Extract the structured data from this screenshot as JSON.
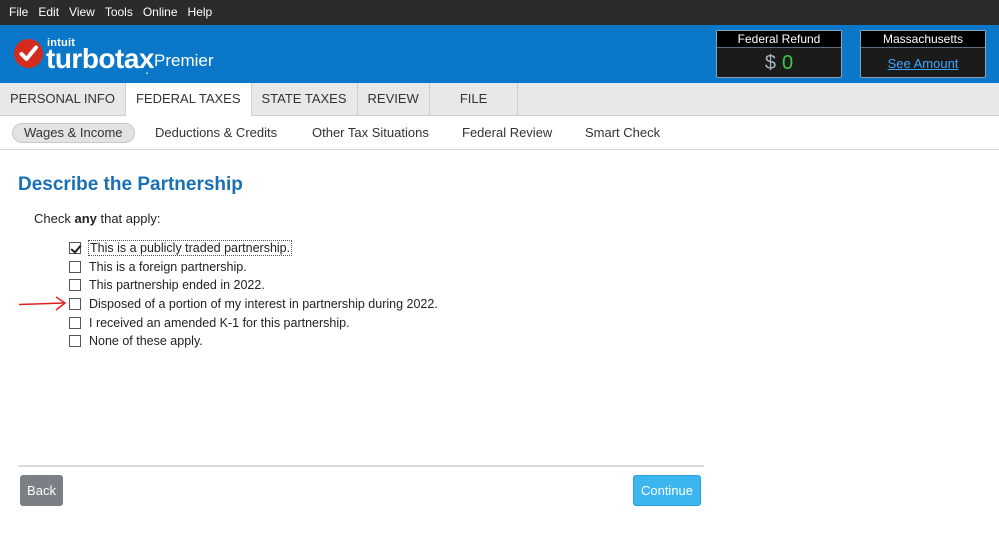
{
  "menu": [
    "File",
    "Edit",
    "View",
    "Tools",
    "Online",
    "Help"
  ],
  "brand": {
    "intuit": "intuit",
    "product": "turbotax",
    "edition": "Premier"
  },
  "refunds": {
    "federal": {
      "label": "Federal Refund",
      "currency": "$",
      "amount": "0"
    },
    "state": {
      "label": "Massachusetts",
      "link": "See Amount"
    }
  },
  "tabs": [
    {
      "label": "PERSONAL INFO",
      "active": false
    },
    {
      "label": "FEDERAL TAXES",
      "active": true
    },
    {
      "label": "STATE TAXES",
      "active": false
    },
    {
      "label": "REVIEW",
      "active": false
    },
    {
      "label": "FILE",
      "active": false
    }
  ],
  "subtabs": [
    {
      "label": "Wages & Income",
      "active": true
    },
    {
      "label": "Deductions & Credits",
      "active": false
    },
    {
      "label": "Other Tax Situations",
      "active": false
    },
    {
      "label": "Federal Review",
      "active": false
    },
    {
      "label": "Smart Check",
      "active": false
    }
  ],
  "page": {
    "title": "Describe the Partnership",
    "instruction_pre": "Check ",
    "instruction_bold": "any",
    "instruction_post": " that apply:"
  },
  "options": [
    {
      "label": "This is a publicly traded partnership.",
      "checked": true
    },
    {
      "label": "This is a foreign partnership.",
      "checked": false
    },
    {
      "label": "This partnership ended in 2022.",
      "checked": false
    },
    {
      "label": "Disposed of a portion of my interest in partnership during 2022.",
      "checked": false
    },
    {
      "label": "I received an amended K-1 for this partnership.",
      "checked": false
    },
    {
      "label": "None of these apply.",
      "checked": false
    }
  ],
  "buttons": {
    "back": "Back",
    "continue": "Continue"
  },
  "colors": {
    "brand_blue": "#0a77c8",
    "title_blue": "#1a6fb5",
    "continue_blue": "#3bb6ef",
    "back_gray": "#7b8086",
    "refund_green": "#3fc74a",
    "annotation_red": "#e02020"
  }
}
